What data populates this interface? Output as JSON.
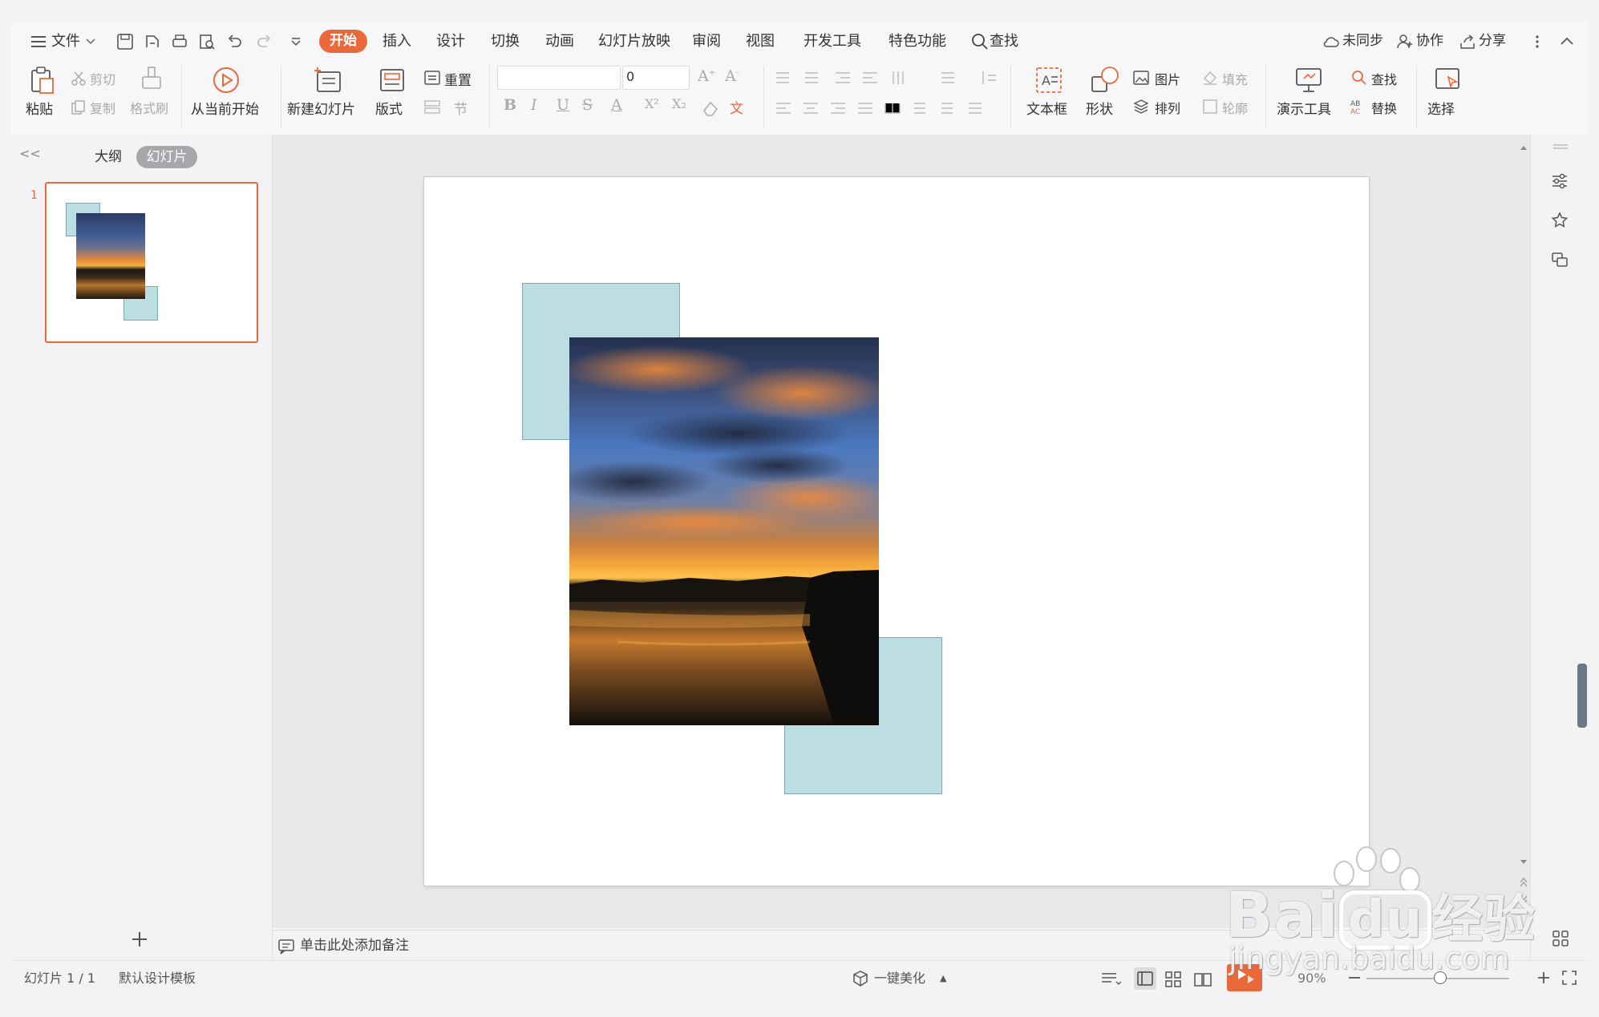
{
  "menu": {
    "file": "文件",
    "tabs": [
      "开始",
      "插入",
      "设计",
      "切换",
      "动画",
      "幻灯片放映",
      "审阅",
      "视图",
      "开发工具",
      "特色功能"
    ],
    "active_tab": "开始",
    "search": "查找",
    "right": {
      "sync": "未同步",
      "collab": "协作",
      "share": "分享"
    }
  },
  "ribbon": {
    "paste": "粘贴",
    "cut": "剪切",
    "copy": "复制",
    "format_painter": "格式刷",
    "from_current": "从当前开始",
    "new_slide": "新建幻灯片",
    "layout": "版式",
    "reset": "重置",
    "section": "节",
    "font_size": "0",
    "text_box": "文本框",
    "shape": "形状",
    "picture": "图片",
    "fill": "填充",
    "arrange": "排列",
    "outline": "轮廓",
    "present_tools": "演示工具",
    "find": "查找",
    "replace": "替换",
    "select": "选择"
  },
  "left_panel": {
    "tab_outline": "大纲",
    "tab_slides": "幻灯片",
    "slide_number": "1",
    "collapse": "<<"
  },
  "notes": {
    "placeholder": "单击此处添加备注"
  },
  "status": {
    "slide_counter": "幻灯片 1 / 1",
    "template": "默认设计模板",
    "beautify": "一键美化",
    "zoom": "90%"
  },
  "watermark": {
    "brand": "Bai",
    "brand2": "du",
    "cn": "经验",
    "url": "jingyan.baidu.com"
  },
  "colors": {
    "accent": "#e9693a",
    "shape_fill": "#bcdde1",
    "shape_border": "#7fa9b0"
  }
}
